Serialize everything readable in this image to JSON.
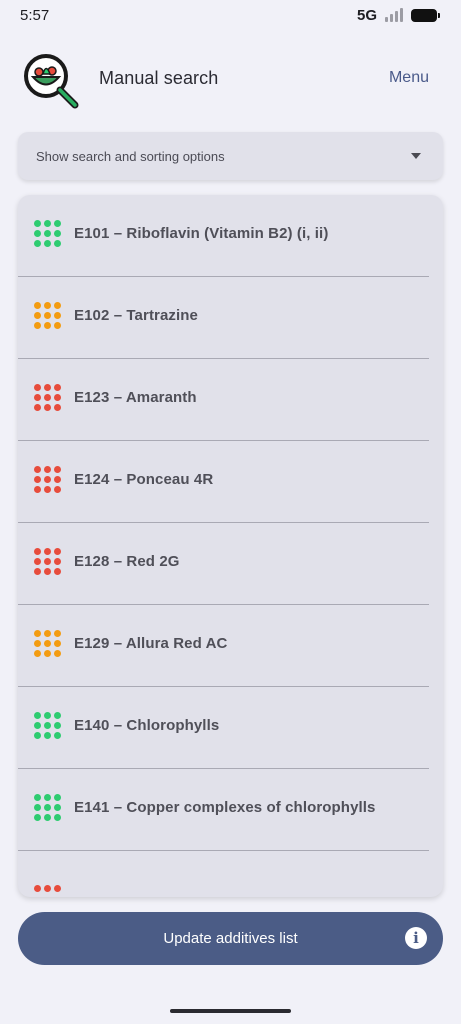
{
  "status": {
    "time": "5:57",
    "network": "5G",
    "icons": [
      "signal-icon",
      "battery-icon"
    ]
  },
  "header": {
    "title": "Manual search",
    "menu_label": "Menu",
    "logo_icon": "magnifier-salad-icon"
  },
  "options": {
    "label": "Show search and sorting options",
    "icon": "caret-down-icon"
  },
  "colors": {
    "green": "#2ecc71",
    "orange": "#f39c12",
    "red": "#e74c3c",
    "accent": "#4b5c86"
  },
  "additives": [
    {
      "label": "E101 – Riboflavin (Vitamin B2) (i, ii)",
      "rating": "green"
    },
    {
      "label": "E102 – Tartrazine",
      "rating": "orange"
    },
    {
      "label": "E123 – Amaranth",
      "rating": "red"
    },
    {
      "label": "E124 – Ponceau 4R",
      "rating": "red"
    },
    {
      "label": "E128 – Red 2G",
      "rating": "red"
    },
    {
      "label": "E129 – Allura Red AC",
      "rating": "orange"
    },
    {
      "label": "E140 – Chlorophylls",
      "rating": "green"
    },
    {
      "label": "E141 – Copper complexes of chlorophylls",
      "rating": "green"
    },
    {
      "label": "",
      "rating": "red"
    }
  ],
  "footer": {
    "update_label": "Update additives list",
    "info_icon": "info-icon"
  }
}
